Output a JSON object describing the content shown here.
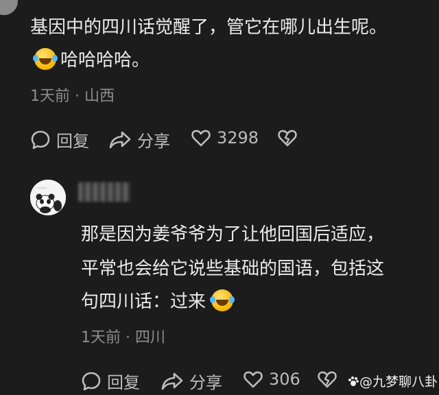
{
  "comment1": {
    "line1": "基因中的四川话觉醒了，管它在哪儿出生呢。",
    "line2": "哈哈哈哈。",
    "meta": "1天前 · 山西",
    "reply_label": "回复",
    "share_label": "分享",
    "like_count": "3298"
  },
  "comment2": {
    "line1": "那是因为姜爷爷为了让他回国后适应，",
    "line2": "平常也会给它说些基础的国语，包括这",
    "line3": "句四川话：过来",
    "meta": "1天前 · 四川",
    "reply_label": "回复",
    "share_label": "分享",
    "like_count": "306"
  },
  "watermark": "@九梦聊八卦"
}
